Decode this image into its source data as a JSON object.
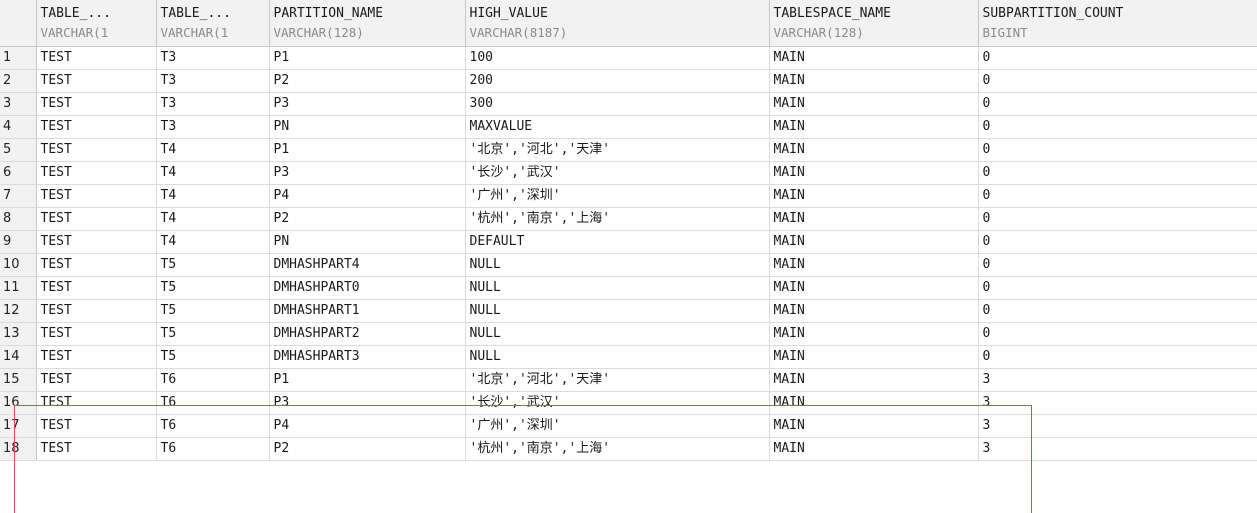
{
  "columns": [
    {
      "name": "TABLE_...",
      "type": "VARCHAR(1"
    },
    {
      "name": "TABLE_...",
      "type": "VARCHAR(1"
    },
    {
      "name": "PARTITION_NAME",
      "type": "VARCHAR(128)"
    },
    {
      "name": "HIGH_VALUE",
      "type": "VARCHAR(8187)"
    },
    {
      "name": "TABLESPACE_NAME",
      "type": "VARCHAR(128)"
    },
    {
      "name": "SUBPARTITION_COUNT",
      "type": "BIGINT"
    }
  ],
  "rows": [
    {
      "num": "1",
      "c0": "TEST",
      "c1": "T3",
      "c2": "P1",
      "c3": "100",
      "c4": "MAIN",
      "c5": "0"
    },
    {
      "num": "2",
      "c0": "TEST",
      "c1": "T3",
      "c2": "P2",
      "c3": "200",
      "c4": "MAIN",
      "c5": "0"
    },
    {
      "num": "3",
      "c0": "TEST",
      "c1": "T3",
      "c2": "P3",
      "c3": "300",
      "c4": "MAIN",
      "c5": "0"
    },
    {
      "num": "4",
      "c0": "TEST",
      "c1": "T3",
      "c2": "PN",
      "c3": "MAXVALUE",
      "c4": "MAIN",
      "c5": "0"
    },
    {
      "num": "5",
      "c0": "TEST",
      "c1": "T4",
      "c2": "P1",
      "c3": "'北京','河北','天津'",
      "c4": "MAIN",
      "c5": "0"
    },
    {
      "num": "6",
      "c0": "TEST",
      "c1": "T4",
      "c2": "P3",
      "c3": "'长沙','武汉'",
      "c4": "MAIN",
      "c5": "0"
    },
    {
      "num": "7",
      "c0": "TEST",
      "c1": "T4",
      "c2": "P4",
      "c3": "'广州','深圳'",
      "c4": "MAIN",
      "c5": "0"
    },
    {
      "num": "8",
      "c0": "TEST",
      "c1": "T4",
      "c2": "P2",
      "c3": "'杭州','南京','上海'",
      "c4": "MAIN",
      "c5": "0"
    },
    {
      "num": "9",
      "c0": "TEST",
      "c1": "T4",
      "c2": "PN",
      "c3": "DEFAULT",
      "c4": "MAIN",
      "c5": "0"
    },
    {
      "num": "10",
      "c0": "TEST",
      "c1": "T5",
      "c2": "DMHASHPART4",
      "c3": "NULL",
      "c4": "MAIN",
      "c5": "0"
    },
    {
      "num": "11",
      "c0": "TEST",
      "c1": "T5",
      "c2": "DMHASHPART0",
      "c3": "NULL",
      "c4": "MAIN",
      "c5": "0"
    },
    {
      "num": "12",
      "c0": "TEST",
      "c1": "T5",
      "c2": "DMHASHPART1",
      "c3": "NULL",
      "c4": "MAIN",
      "c5": "0"
    },
    {
      "num": "13",
      "c0": "TEST",
      "c1": "T5",
      "c2": "DMHASHPART2",
      "c3": "NULL",
      "c4": "MAIN",
      "c5": "0"
    },
    {
      "num": "14",
      "c0": "TEST",
      "c1": "T5",
      "c2": "DMHASHPART3",
      "c3": "NULL",
      "c4": "MAIN",
      "c5": "0"
    },
    {
      "num": "15",
      "c0": "TEST",
      "c1": "T6",
      "c2": "P1",
      "c3": "'北京','河北','天津'",
      "c4": "MAIN",
      "c5": "3"
    },
    {
      "num": "16",
      "c0": "TEST",
      "c1": "T6",
      "c2": "P3",
      "c3": "'长沙','武汉'",
      "c4": "MAIN",
      "c5": "3"
    },
    {
      "num": "17",
      "c0": "TEST",
      "c1": "T6",
      "c2": "P4",
      "c3": "'广州','深圳'",
      "c4": "MAIN",
      "c5": "3"
    },
    {
      "num": "18",
      "c0": "TEST",
      "c1": "T6",
      "c2": "P2",
      "c3": "'杭州','南京','上海'",
      "c4": "MAIN",
      "c5": "3"
    }
  ],
  "colors": {
    "highlight": "#e04a4a",
    "header_bg": "#f2f2f2",
    "grid_line": "#dcdcdc"
  }
}
